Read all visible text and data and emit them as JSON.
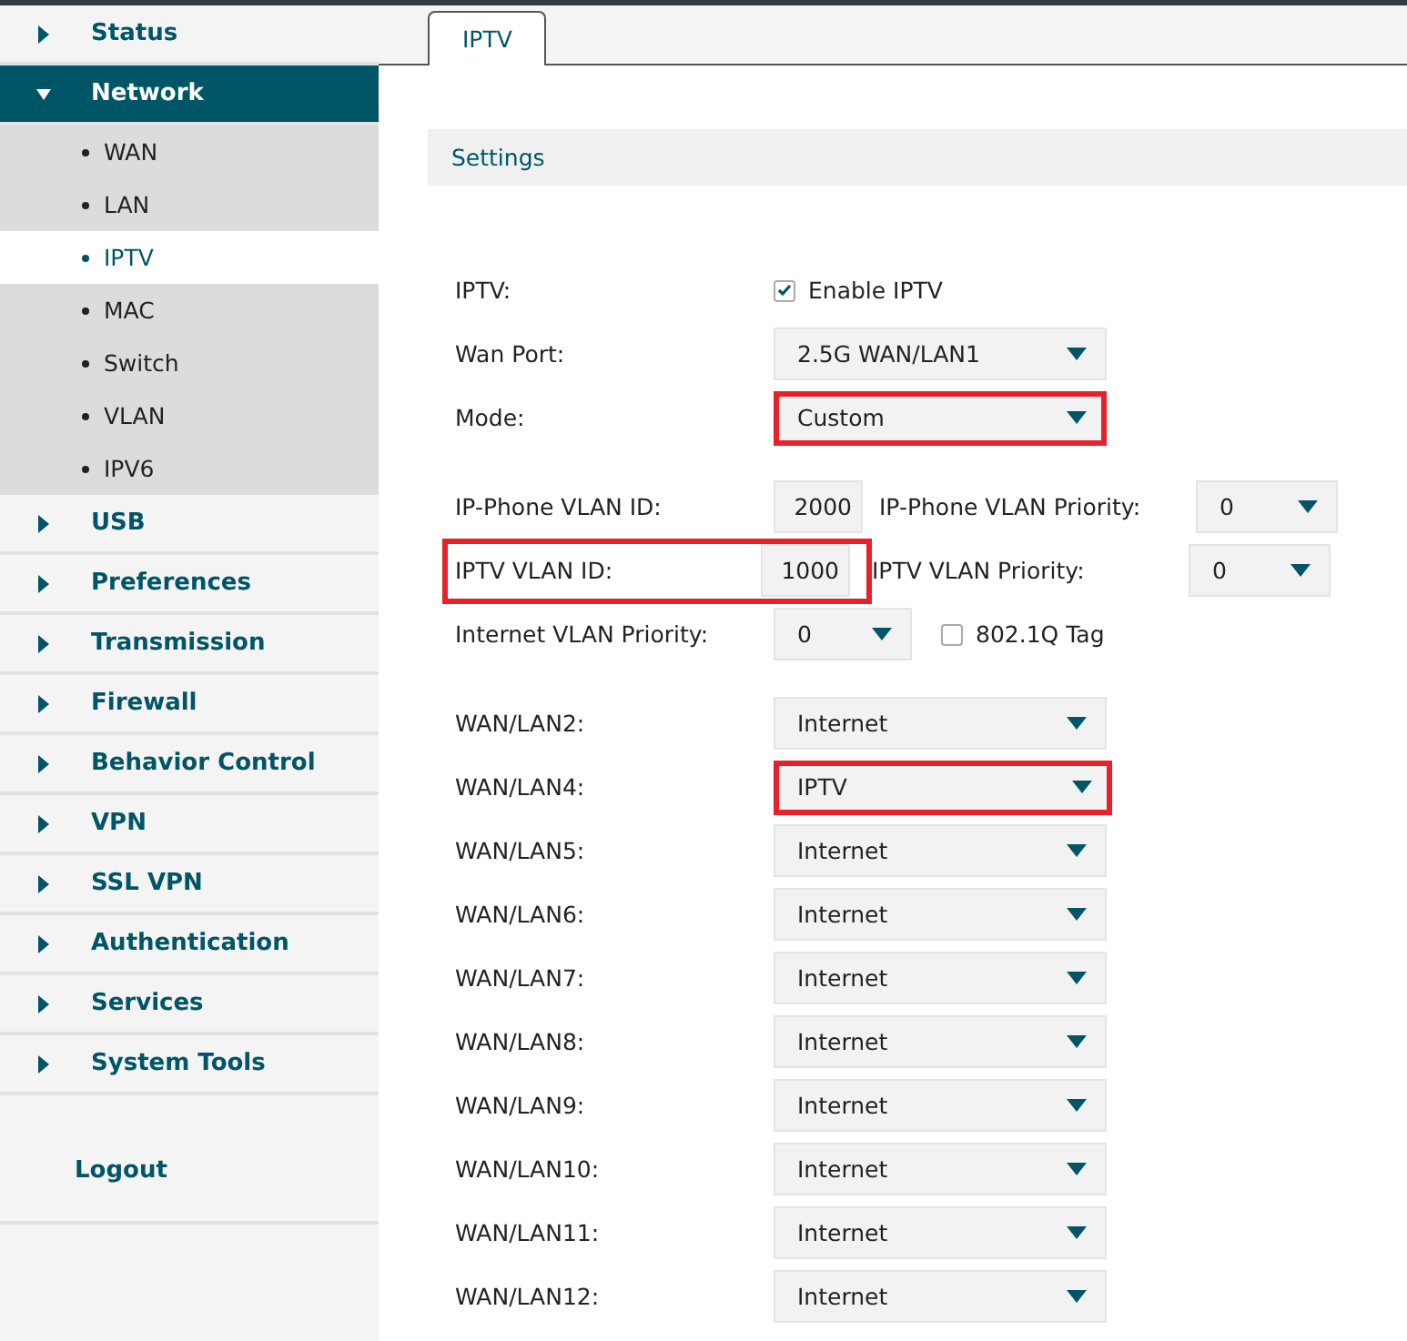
{
  "sidebar": {
    "items": [
      {
        "label": "Status",
        "expanded": false
      },
      {
        "label": "Network",
        "expanded": true,
        "children": [
          {
            "label": "WAN",
            "selected": false
          },
          {
            "label": "LAN",
            "selected": false
          },
          {
            "label": "IPTV",
            "selected": true
          },
          {
            "label": "MAC",
            "selected": false
          },
          {
            "label": "Switch",
            "selected": false
          },
          {
            "label": "VLAN",
            "selected": false
          },
          {
            "label": "IPV6",
            "selected": false
          }
        ]
      },
      {
        "label": "USB",
        "expanded": false
      },
      {
        "label": "Preferences",
        "expanded": false
      },
      {
        "label": "Transmission",
        "expanded": false
      },
      {
        "label": "Firewall",
        "expanded": false
      },
      {
        "label": "Behavior Control",
        "expanded": false
      },
      {
        "label": "VPN",
        "expanded": false
      },
      {
        "label": "SSL VPN",
        "expanded": false
      },
      {
        "label": "Authentication",
        "expanded": false
      },
      {
        "label": "Services",
        "expanded": false
      },
      {
        "label": "System Tools",
        "expanded": false
      }
    ],
    "logout": "Logout"
  },
  "tabs": [
    {
      "label": "IPTV",
      "selected": true
    }
  ],
  "section_title": "Settings",
  "top_fields": [
    {
      "kind": "checkbox",
      "label": "IPTV:",
      "text": "Enable IPTV",
      "checked": true
    },
    {
      "kind": "select",
      "label": "Wan Port:",
      "value": "2.5G WAN/LAN1",
      "highlighted": false
    },
    {
      "kind": "select",
      "label": "Mode:",
      "value": "Custom",
      "highlighted": true
    }
  ],
  "vlan_rows": [
    {
      "kind": "id",
      "label": "IP-Phone VLAN ID:",
      "value": "2000",
      "highlighted": false,
      "priority_label": "IP-Phone VLAN Priority:",
      "priority": "0"
    },
    {
      "kind": "id",
      "label": "IPTV VLAN ID:",
      "value": "1000",
      "highlighted": true,
      "priority_label": "IPTV VLAN Priority:",
      "priority": "0"
    },
    {
      "kind": "priority",
      "label": "Internet VLAN Priority:",
      "value": "0",
      "tag_label": "802.1Q Tag",
      "tag_checked": false
    }
  ],
  "ports": [
    {
      "label": "WAN/LAN2:",
      "value": "Internet",
      "highlighted": false
    },
    {
      "label": "WAN/LAN4:",
      "value": "IPTV",
      "highlighted": true
    },
    {
      "label": "WAN/LAN5:",
      "value": "Internet",
      "highlighted": false
    },
    {
      "label": "WAN/LAN6:",
      "value": "Internet",
      "highlighted": false
    },
    {
      "label": "WAN/LAN7:",
      "value": "Internet",
      "highlighted": false
    },
    {
      "label": "WAN/LAN8:",
      "value": "Internet",
      "highlighted": false
    },
    {
      "label": "WAN/LAN9:",
      "value": "Internet",
      "highlighted": false
    },
    {
      "label": "WAN/LAN10:",
      "value": "Internet",
      "highlighted": false
    },
    {
      "label": "WAN/LAN11:",
      "value": "Internet",
      "highlighted": false
    },
    {
      "label": "WAN/LAN12:",
      "value": "Internet",
      "highlighted": false
    }
  ]
}
